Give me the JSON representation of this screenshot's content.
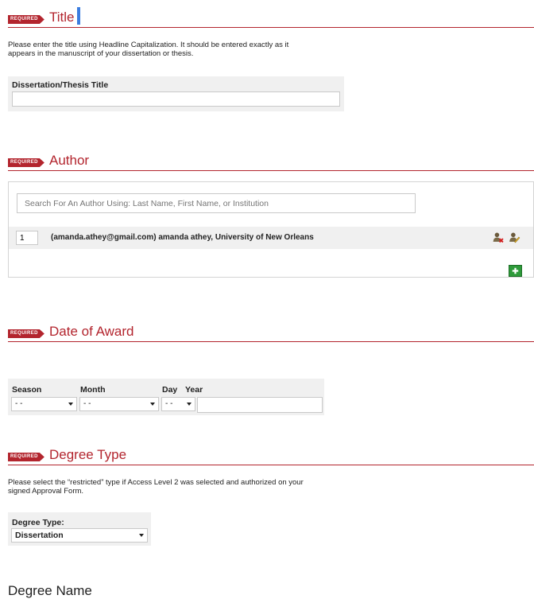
{
  "required_badge": "REQUIRED",
  "sections": {
    "title": {
      "heading": "Title",
      "instructions": [
        "Please enter the title using Headline Capitalization. It should be entered exactly as it",
        "appears in the manuscript of your dissertation or thesis."
      ],
      "field_label": "Dissertation/Thesis Title",
      "field_value": ""
    },
    "author": {
      "heading": "Author",
      "search_placeholder": "Search For An Author Using: Last Name, First Name, or Institution",
      "authors": [
        {
          "order": "1",
          "text": "(amanda.athey@gmail.com) amanda athey, University of New Orleans"
        }
      ],
      "icons": [
        "remove-author-icon",
        "edit-author-icon",
        "add-author-icon"
      ]
    },
    "date_of_award": {
      "heading": "Date of Award",
      "season_label": "Season",
      "season_value": "- -",
      "month_label": "Month",
      "month_value": "- -",
      "day_label": "Day",
      "day_value": "- -",
      "year_label": "Year",
      "year_value": ""
    },
    "degree_type": {
      "heading": "Degree Type",
      "instructions": [
        "Please select the “restricted” type if Access Level 2 was selected and authorized on your",
        "signed Approval Form."
      ],
      "field_label": "Degree Type:",
      "selected": "Dissertation"
    },
    "degree_name": {
      "heading": "Degree Name"
    }
  },
  "colors": {
    "accent": "#b3252e",
    "field_background": "#f0f0f0",
    "add_button": "#2e9a3a",
    "cursor": "#3b7de0"
  }
}
